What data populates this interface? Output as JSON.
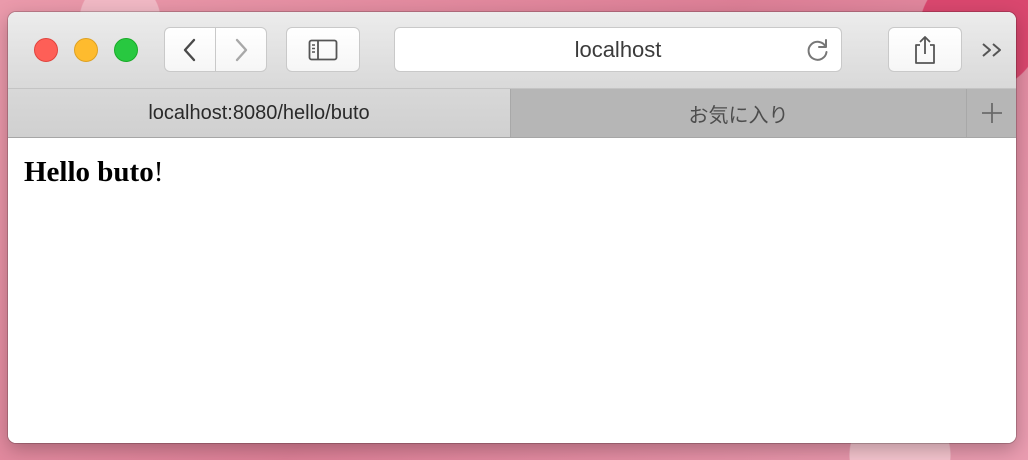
{
  "window": {
    "toolbar": {
      "address_text": "localhost"
    },
    "tabs": [
      {
        "label": "localhost:8080/hello/buto",
        "active": true
      },
      {
        "label": "お気に入り",
        "active": false
      }
    ],
    "page": {
      "heading_bold": "Hello buto",
      "heading_tail": "!"
    }
  },
  "icons": {
    "close": "close-traffic-light",
    "minimize": "minimize-traffic-light",
    "zoom": "zoom-traffic-light",
    "back": "chevron-left-icon",
    "forward": "chevron-right-icon",
    "sidebar": "sidebar-icon",
    "reload": "reload-icon",
    "share": "share-icon",
    "overflow": "double-chevron-icon",
    "new_tab": "plus-icon"
  },
  "colors": {
    "close": "#fe5f57",
    "minimize": "#febb2e",
    "zoom": "#28c840"
  }
}
